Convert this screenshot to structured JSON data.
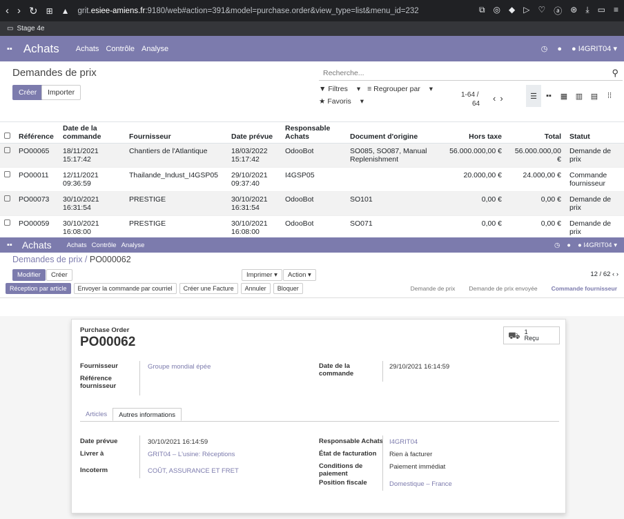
{
  "browser": {
    "url_prefix": "grit.",
    "url_host": "esiee-amiens.fr",
    "url_rest": ":9180/web#action=391&model=purchase.order&view_type=list&menu_id=232",
    "bookmark": "Stage 4e"
  },
  "top1": {
    "app": "Achats",
    "menus": [
      "Achats",
      "Contrôle",
      "Analyse"
    ],
    "user": "I4GRIT04"
  },
  "list": {
    "title": "Demandes de prix",
    "create": "Créer",
    "import": "Importer",
    "search_placeholder": "Recherche...",
    "filters": "Filtres",
    "group_by": "Regrouper par",
    "favorites": "Favoris",
    "pager": "1-64 /",
    "pager_total": "64",
    "headers": [
      "Référence",
      "Date de la commande",
      "Fournisseur",
      "Date prévue",
      "Responsable Achats",
      "Document d'origine",
      "Hors taxe",
      "Total",
      "Statut"
    ],
    "rows": [
      [
        "PO00065",
        "18/11/2021 15:17:42",
        "Chantiers de l'Atlantique",
        "18/03/2022 15:17:42",
        "OdooBot",
        "SO085, SO087, Manual Replenishment",
        "56.000.000,00 €",
        "56.000.000,00 €",
        "Demande de prix"
      ],
      [
        "PO00011",
        "12/11/2021 09:36:59",
        "Thailande_Indust_I4GSP05",
        "29/10/2021 09:37:40",
        "I4GSP05",
        "",
        "20.000,00 €",
        "24.000,00 €",
        "Commande fournisseur"
      ],
      [
        "PO00073",
        "30/10/2021 16:31:54",
        "PRESTIGE",
        "30/10/2021 16:31:54",
        "OdooBot",
        "SO101",
        "0,00 €",
        "0,00 €",
        "Demande de prix"
      ],
      [
        "PO00059",
        "30/10/2021 16:08:00",
        "PRESTIGE",
        "30/10/2021 16:08:00",
        "OdooBot",
        "SO071",
        "0,00 €",
        "0,00 €",
        "Demande de prix"
      ]
    ]
  },
  "top2": {
    "app": "Achats",
    "menus": [
      "Achats",
      "Contrôle",
      "Analyse"
    ],
    "user": "I4GRIT04"
  },
  "form": {
    "bc_parent": "Demandes de prix",
    "bc_sep": " / ",
    "bc_current": "PO000062",
    "edit": "Modifier",
    "create": "Créer",
    "print": "Imprimer",
    "action": "Action",
    "pager": "12 / 62",
    "actions": [
      "Réception par article",
      "Envoyer la commande par courriel",
      "Créer une Facture",
      "Annuler",
      "Bloquer"
    ],
    "stages": [
      "Demande de prix",
      "Demande de prix envoyée",
      "Commande fournisseur"
    ],
    "doc_type": "Purchase Order",
    "doc_name": "PO00062",
    "smart_count": "1",
    "smart_label": "Reçu",
    "supplier_label": "Fournisseur",
    "supplier": "Groupe mondial épée",
    "ref_label": "Référence fournisseur",
    "order_date_label": "Date de la commande",
    "order_date": "29/10/2021 16:14:59",
    "tabs": [
      "Articles",
      "Autres informations"
    ],
    "planned_label": "Date prévue",
    "planned": "30/10/2021 16:14:59",
    "deliver_label": "Livrer à",
    "deliver": "GRIT04 – L'usine: Réceptions",
    "incoterm_label": "Incoterm",
    "incoterm": "COÛT, ASSURANCE ET FRET",
    "buyer_label": "Responsable Achats",
    "buyer": "I4GRIT04",
    "billing_label": "État de facturation",
    "billing": "Rien à facturer",
    "payment_label": "Conditions de paiement",
    "payment": "Paiement immédiat",
    "fiscal_label": "Position fiscale",
    "fiscal": "Domestique – France"
  }
}
